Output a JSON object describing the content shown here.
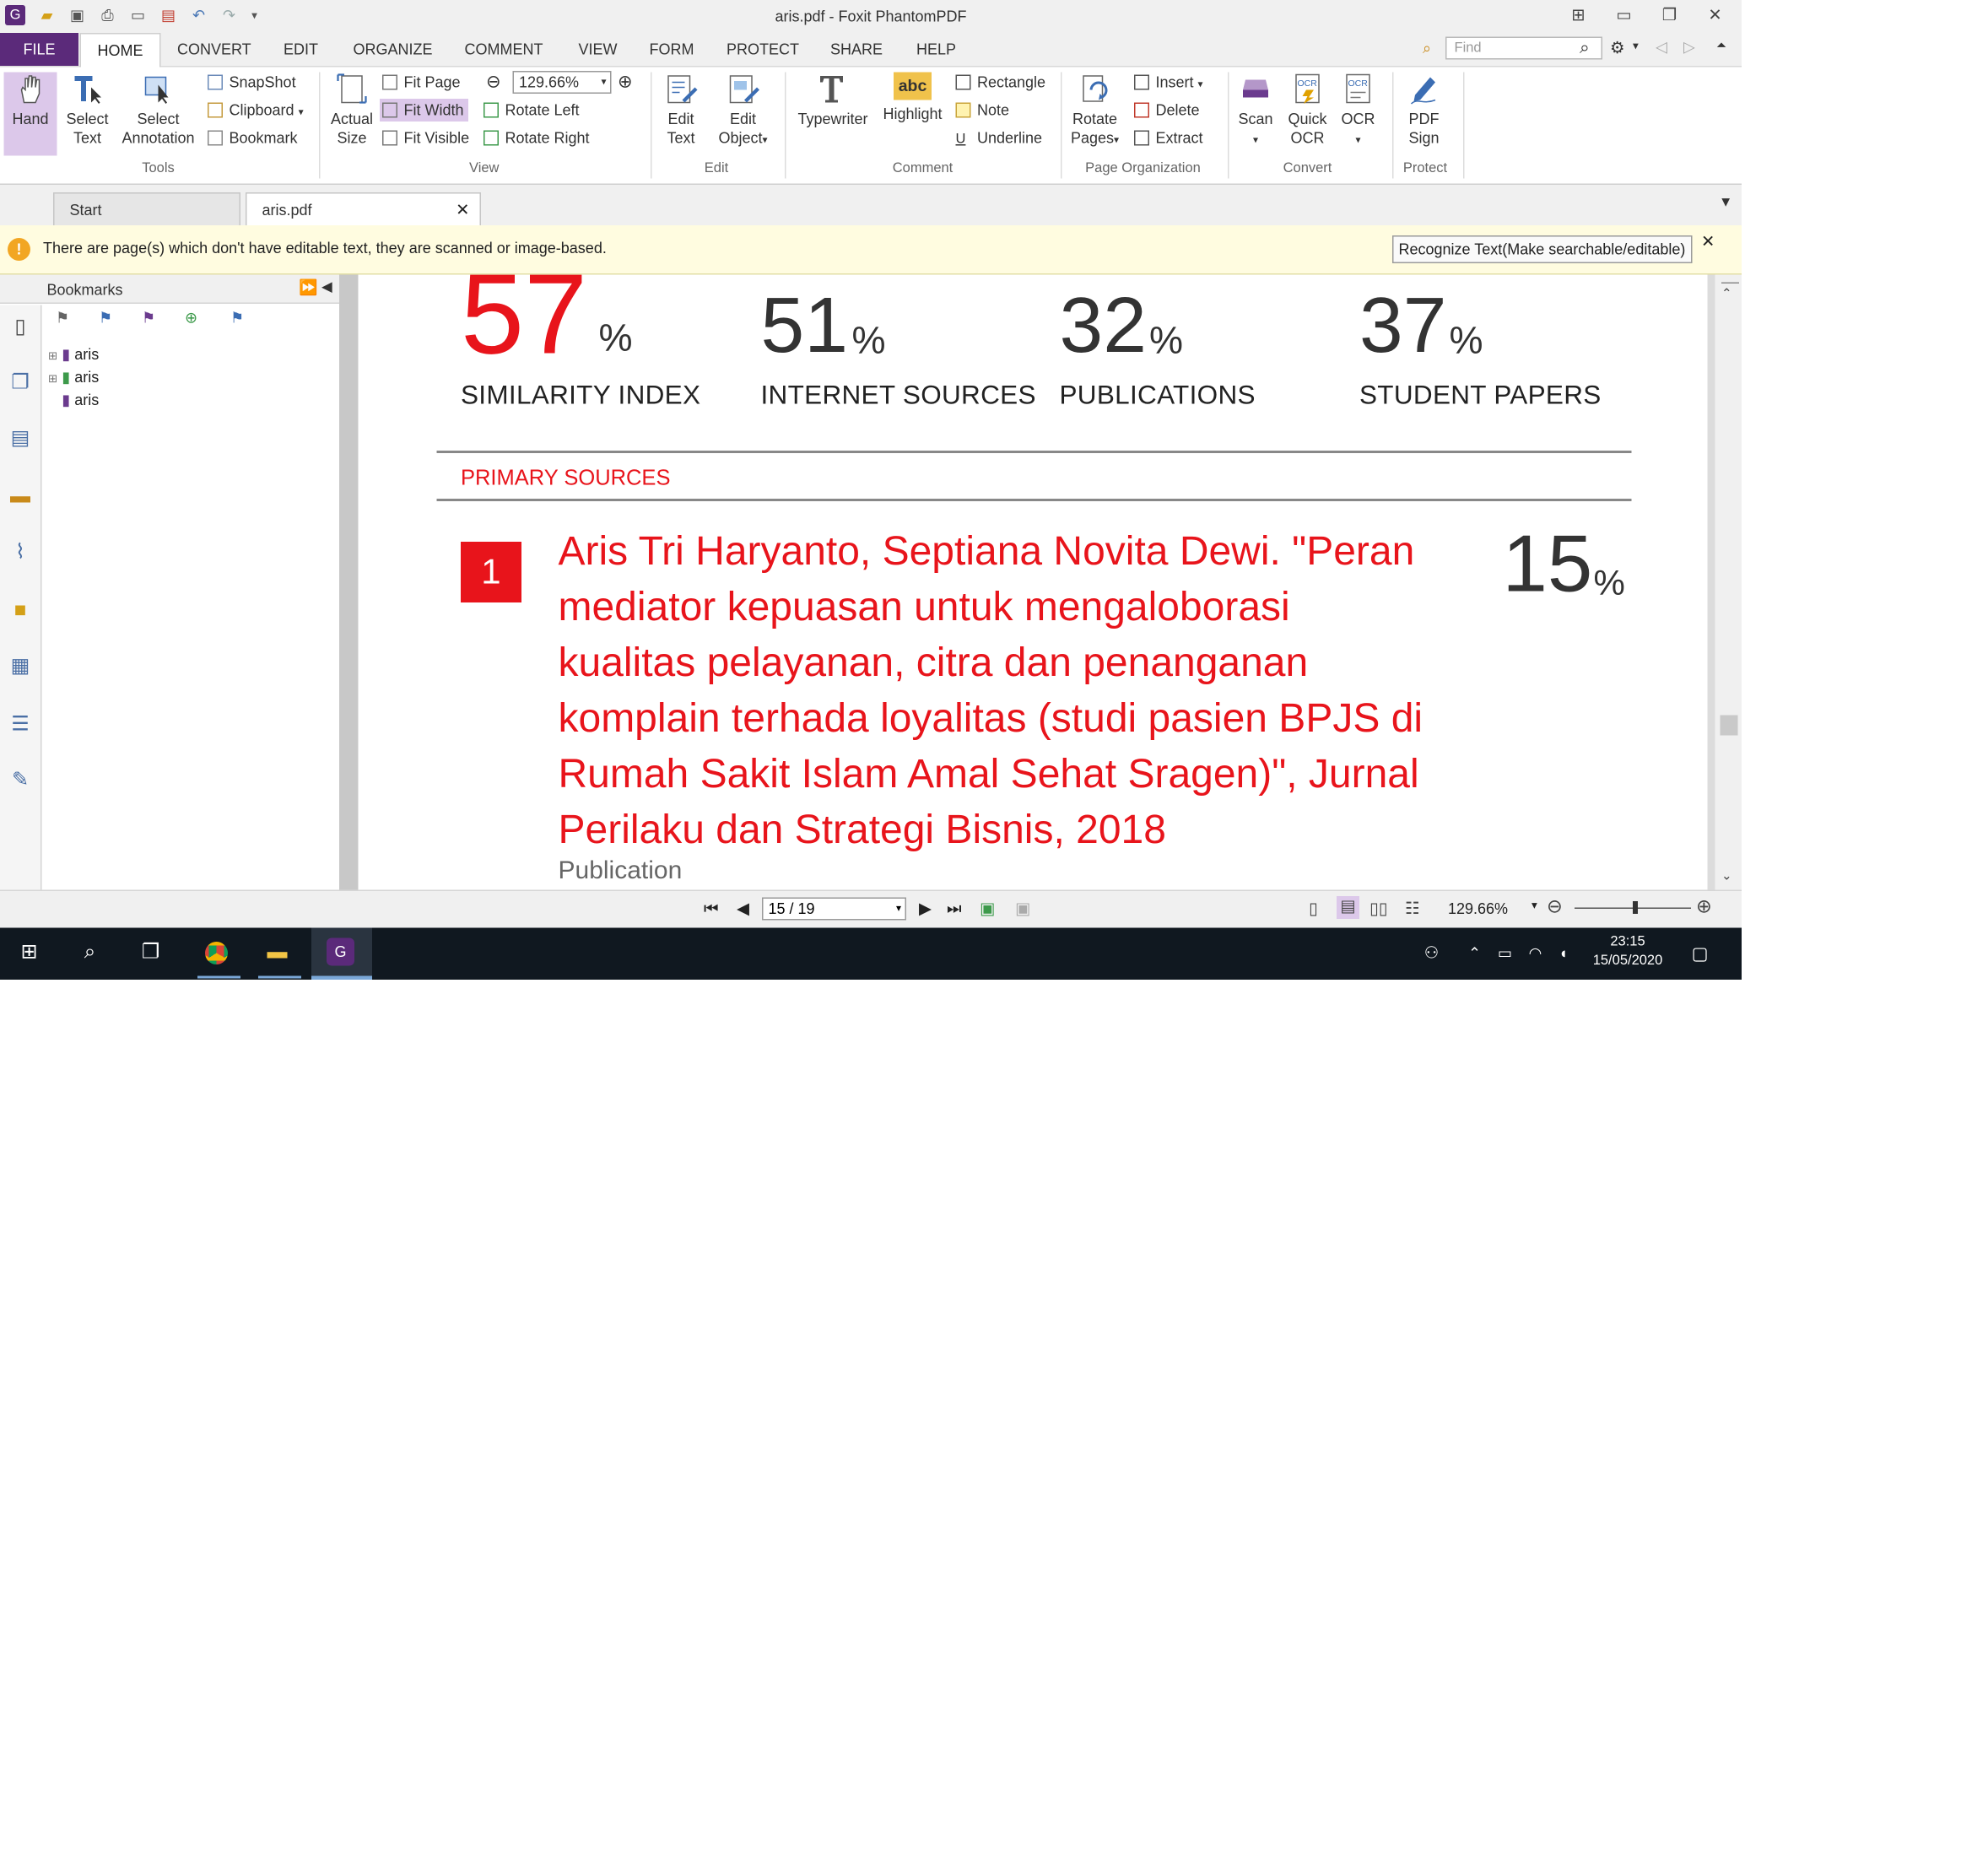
{
  "window": {
    "title": "aris.pdf - Foxit PhantomPDF",
    "controls": {
      "ribbon_toggle": "⊞",
      "minimize": "▭",
      "restore": "❐",
      "close": "✕"
    }
  },
  "menu": {
    "file": "FILE",
    "items": [
      "HOME",
      "CONVERT",
      "EDIT",
      "ORGANIZE",
      "COMMENT",
      "VIEW",
      "FORM",
      "PROTECT",
      "SHARE",
      "HELP"
    ],
    "search_placeholder": "Find"
  },
  "ribbon": {
    "tools": {
      "hand": "Hand",
      "select_text": [
        "Select",
        "Text"
      ],
      "select_annotation": [
        "Select",
        "Annotation"
      ],
      "snapshot": "SnapShot",
      "clipboard": "Clipboard",
      "bookmark": "Bookmark",
      "group": "Tools"
    },
    "view": {
      "actual_size": [
        "Actual",
        "Size"
      ],
      "fit_page": "Fit Page",
      "fit_width": "Fit Width",
      "fit_visible": "Fit Visible",
      "zoom": "129.66%",
      "rotate_left": "Rotate Left",
      "rotate_right": "Rotate Right",
      "group": "View"
    },
    "edit": {
      "edit_text": [
        "Edit",
        "Text"
      ],
      "edit_object": [
        "Edit",
        "Object"
      ],
      "group": "Edit"
    },
    "comment": {
      "typewriter": "Typewriter",
      "highlight": "Highlight",
      "highlight_icon_text": "abc",
      "rectangle": "Rectangle",
      "note": "Note",
      "underline": "Underline",
      "group": "Comment"
    },
    "page_org": {
      "rotate_pages": [
        "Rotate",
        "Pages"
      ],
      "insert": "Insert",
      "delete": "Delete",
      "extract": "Extract",
      "group": "Page Organization"
    },
    "convert": {
      "scan": "Scan",
      "quick_ocr": [
        "Quick",
        "OCR"
      ],
      "ocr": "OCR",
      "group": "Convert"
    },
    "protect": {
      "pdf_sign": [
        "PDF",
        "Sign"
      ],
      "group": "Protect"
    }
  },
  "tabs": {
    "start": "Start",
    "doc": "aris.pdf"
  },
  "infobar": {
    "message": "There are page(s) which don't have editable text, they are scanned or image-based.",
    "button": "Recognize Text(Make searchable/editable)"
  },
  "bookmarks": {
    "title": "Bookmarks",
    "items": [
      "aris",
      "aris",
      "aris"
    ]
  },
  "document": {
    "stats": [
      {
        "value": "57",
        "pct": "%",
        "label": "SIMILARITY INDEX"
      },
      {
        "value": "51",
        "pct": "%",
        "label": "INTERNET SOURCES"
      },
      {
        "value": "32",
        "pct": "%",
        "label": "PUBLICATIONS"
      },
      {
        "value": "37",
        "pct": "%",
        "label": "STUDENT PAPERS"
      }
    ],
    "primary_sources_heading": "PRIMARY SOURCES",
    "source": {
      "number": "1",
      "lines": [
        "Aris Tri Haryanto, Septiana Novita Dewi. \"Peran",
        "mediator kepuasan untuk mengaloborasi",
        "kualitas pelayanan, citra dan penanganan",
        "komplain terhada loyalitas (studi pasien BPJS di",
        "Rumah Sakit Islam Amal Sehat Sragen)\", Jurnal",
        "Perilaku dan Strategi Bisnis, 2018"
      ],
      "type": "Publication",
      "percent": "15",
      "pct": "%"
    }
  },
  "status": {
    "page": "15 / 19",
    "zoom": "129.66%"
  },
  "taskbar": {
    "time": "23:15",
    "date": "15/05/2020"
  },
  "colors": {
    "accent_red": "#e8141b",
    "file_tab": "#5b2a7a",
    "taskbar": "#101820"
  }
}
